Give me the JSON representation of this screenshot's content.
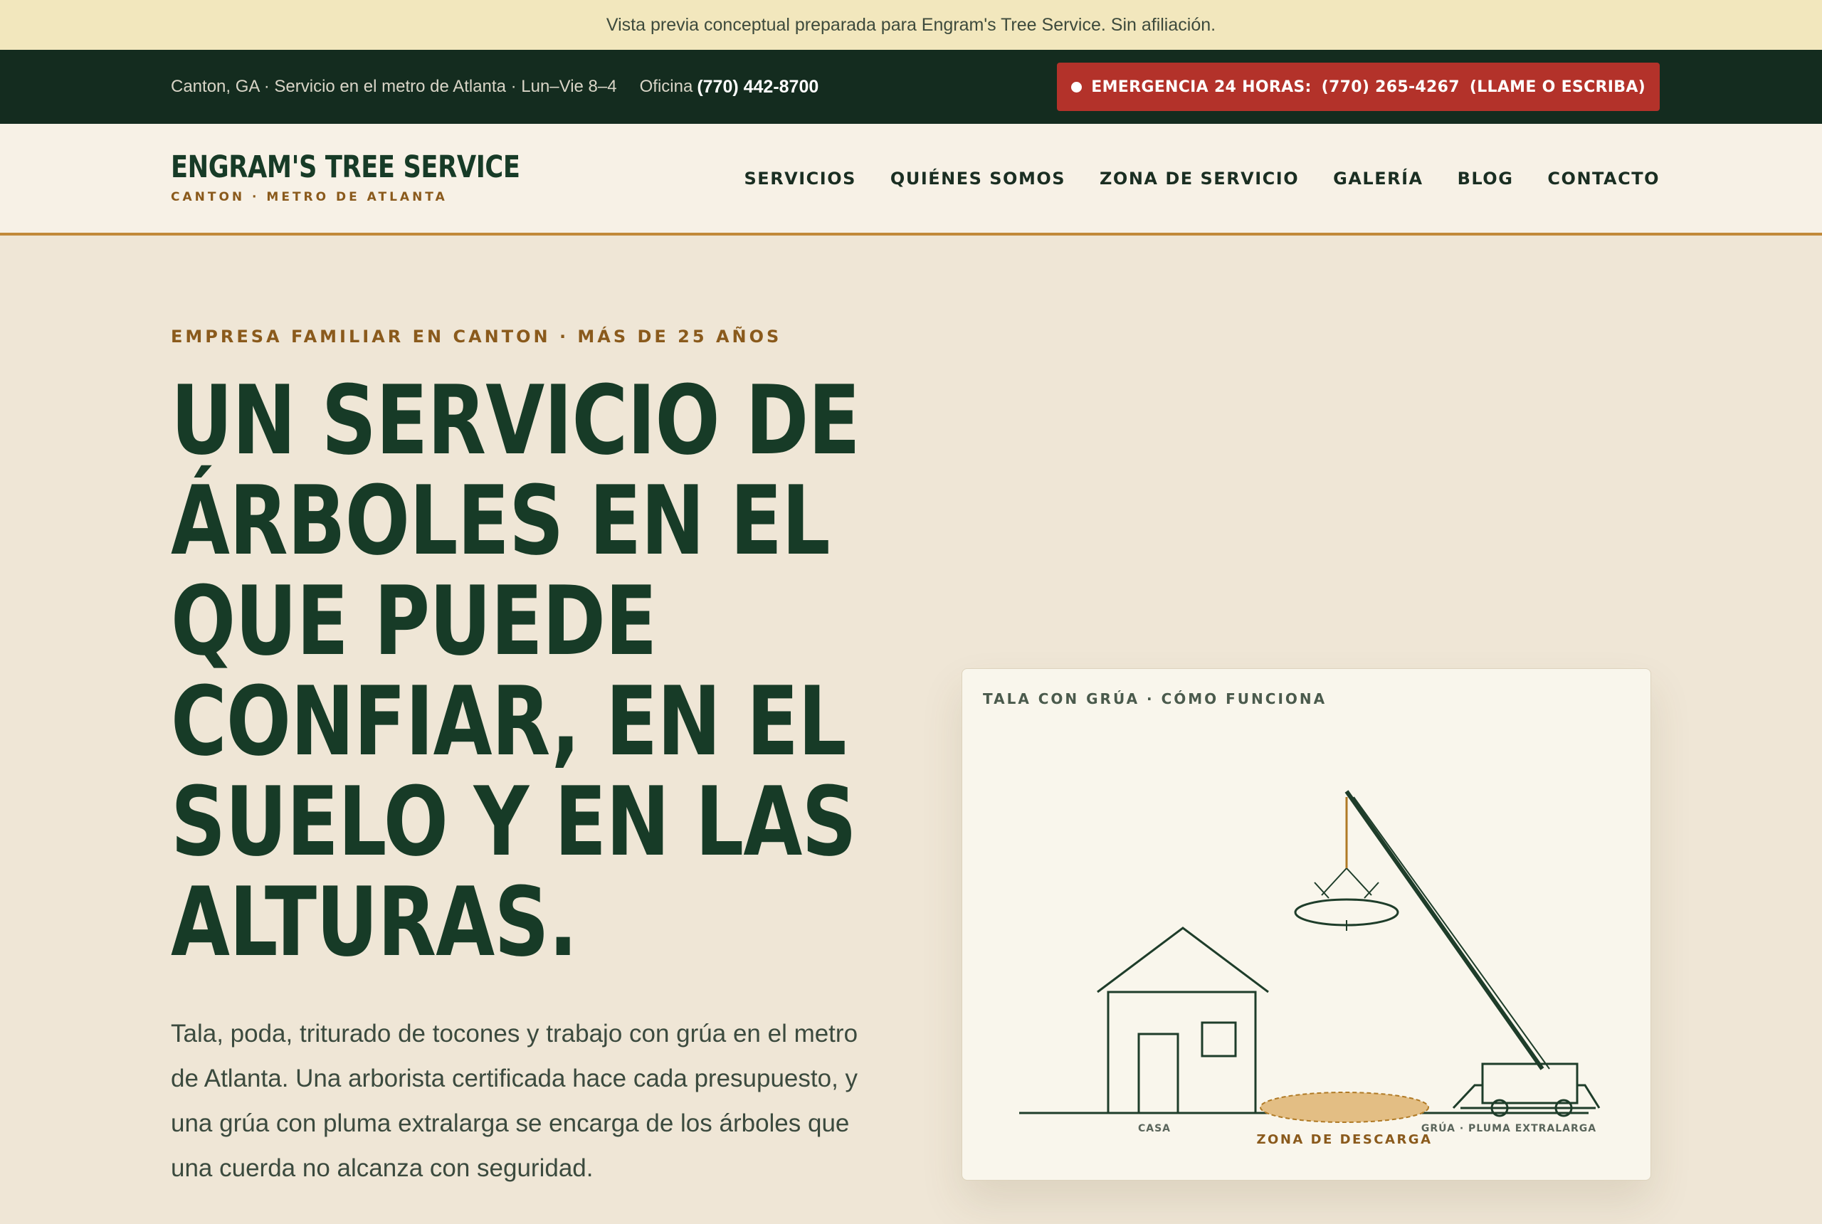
{
  "preview_notice": "Vista previa conceptual preparada para Engram's Tree Service. Sin afiliación.",
  "topbar": {
    "location": "Canton, GA · Servicio en el metro de Atlanta · Lun–Vie 8–4",
    "office_label": "Oficina",
    "office_phone": "(770) 442-8700",
    "emergency_label": "EMERGENCIA 24 HORAS:",
    "emergency_phone": "(770) 265-4267",
    "emergency_note": "(LLAME O ESCRIBA)"
  },
  "header": {
    "brand": "ENGRAM'S TREE SERVICE",
    "tagline": "CANTON · METRO DE ATLANTA",
    "nav": [
      "SERVICIOS",
      "QUIÉNES SOMOS",
      "ZONA DE SERVICIO",
      "GALERÍA",
      "BLOG",
      "CONTACTO"
    ]
  },
  "hero": {
    "eyebrow": "EMPRESA FAMILIAR EN CANTON · MÁS DE 25 AÑOS",
    "headline_lines": [
      "UN SERVICIO DE",
      "ÁRBOLES EN EL",
      "QUE PUEDE",
      "CONFIAR, EN EL",
      "SUELO Y EN LAS",
      "ALTURAS."
    ],
    "lede": "Tala, poda, triturado de tocones y trabajo con grúa en el metro de Atlanta. Una arborista certificada hace cada presupuesto, y una grúa con pluma extralarga se encarga de los árboles que una cuerda no alcanza con seguridad."
  },
  "diagram": {
    "title": "TALA CON GRÚA · CÓMO FUNCIONA",
    "house_label": "CASA",
    "drop_zone_label": "ZONA DE DESCARGA",
    "crane_label": "GRÚA · PLUMA EXTRALARGA",
    "colors": {
      "line": "#1e3d2a",
      "drop_zone": "#e3be84",
      "cable": "#b07a25"
    }
  }
}
